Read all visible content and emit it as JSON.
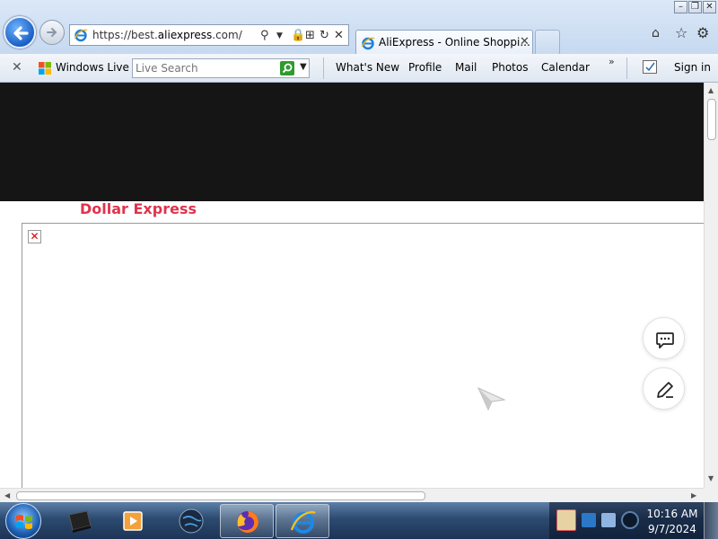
{
  "browser": {
    "address_prefix": "https://best.",
    "address_domain": "aliexpress",
    "address_suffix": ".com/",
    "tab_title": "AliExpress - Online Shoppi...",
    "tab_close": "✕"
  },
  "live_toolbar": {
    "close_glyph": "✕",
    "brand_label": "Windows Live",
    "search_placeholder": "Live Search",
    "links": [
      "What's New",
      "Profile",
      "Mail",
      "Photos",
      "Calendar"
    ],
    "more_glyph": "»",
    "sign_in": "Sign in"
  },
  "page": {
    "brand": "Dollar Express",
    "broken_image_glyph": "✕"
  },
  "taskbar": {
    "clock_time": "10:16 AM",
    "clock_date": "9/7/2024"
  },
  "colors": {
    "brand_red": "#e0334d",
    "header_dark": "#151515",
    "taskbar": "#2c4a70"
  },
  "icons": [
    "back-arrow-icon",
    "forward-arrow-icon",
    "ie-icon",
    "search-icon",
    "lock-icon",
    "refresh-icon",
    "stop-icon",
    "home-icon",
    "favorites-star-icon",
    "gear-icon",
    "windows-live-logo-icon",
    "chat-bubble-icon",
    "edit-pen-icon",
    "windows-start-icon"
  ]
}
